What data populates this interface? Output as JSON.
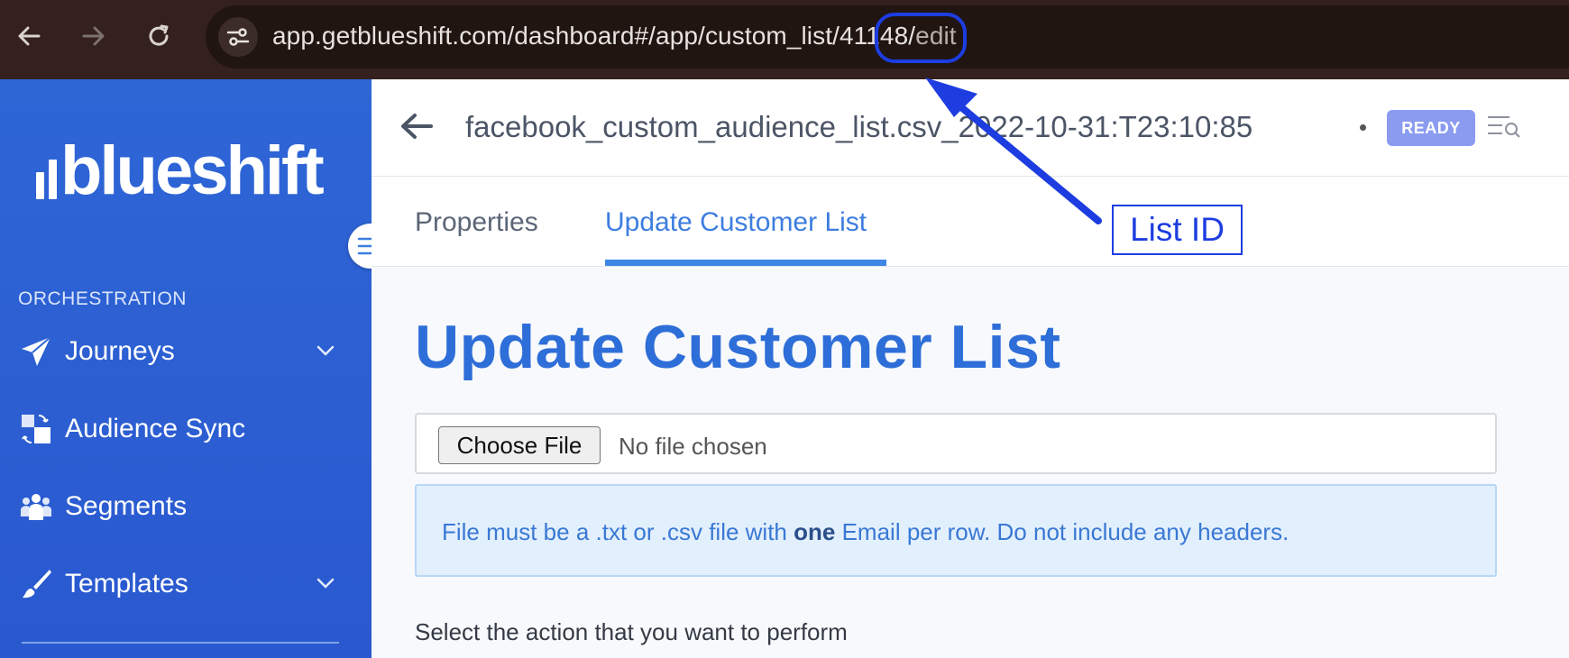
{
  "browser": {
    "url_host_path": "app.getblueshift.com/dashboard#/app/custom_list/",
    "url_list_id": "41148/",
    "url_tail": "edit"
  },
  "sidebar": {
    "logo": "blueshift",
    "section_label": "ORCHESTRATION",
    "items": [
      {
        "label": "Journeys",
        "icon": "paper-plane-icon",
        "has_chevron": true
      },
      {
        "label": "Audience Sync",
        "icon": "sync-squares-icon",
        "has_chevron": false
      },
      {
        "label": "Segments",
        "icon": "people-group-icon",
        "has_chevron": false
      },
      {
        "label": "Templates",
        "icon": "brush-icon",
        "has_chevron": true
      }
    ]
  },
  "header": {
    "title": "facebook_custom_audience_list.csv_2022-10-31:T23:10:85",
    "status": "READY"
  },
  "tabs": [
    {
      "label": "Properties",
      "active": false
    },
    {
      "label": "Update Customer List",
      "active": true
    }
  ],
  "content": {
    "heading": "Update Customer List",
    "choose_file_label": "Choose File",
    "no_file_text": "No file chosen",
    "info_pre": "File must be a .txt or .csv file with ",
    "info_bold": "one",
    "info_post": " Email per row. Do not include any headers.",
    "action_label": "Select the action that you want to perform"
  },
  "annotation": {
    "label": "List ID"
  },
  "colors": {
    "sidebar": "#2e66d6",
    "accent": "#3d7de0",
    "badge": "#8a9bf0",
    "annotation": "#1d3de0"
  }
}
